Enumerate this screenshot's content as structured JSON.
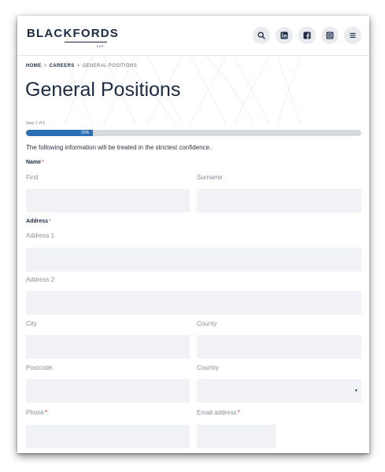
{
  "header": {
    "logo_text": "BLACKFORDS",
    "logo_sub": "LLP",
    "icons": [
      "search-icon",
      "linkedin-icon",
      "facebook-icon",
      "instagram-icon",
      "menu-icon"
    ]
  },
  "breadcrumb": {
    "home": "HOME",
    "sep1": ">",
    "careers": "CAREERS",
    "sep2": ">",
    "current": "GENERAL POSITIONS"
  },
  "page": {
    "title": "General Positions"
  },
  "progress": {
    "step_text": "Step 1 of 5",
    "percent": 20,
    "percent_text": "20%"
  },
  "form": {
    "intro": "The following information will be treated in the strictest confidence.",
    "required_marker": "*",
    "name": {
      "label": "Name",
      "first_label": "First",
      "first_value": "",
      "surname_label": "Surname",
      "surname_value": ""
    },
    "address": {
      "label": "Address",
      "address1_label": "Address 1",
      "address1_value": "",
      "address2_label": "Address 2",
      "address2_value": "",
      "city_label": "City",
      "city_value": "",
      "county_label": "County",
      "county_value": "",
      "postcode_label": "Postcode",
      "postcode_value": "",
      "country_label": "Country",
      "country_value": ""
    },
    "phone": {
      "label": "Phone",
      "value": ""
    },
    "email": {
      "label": "Email address",
      "value": ""
    }
  },
  "colors": {
    "brand_navy": "#1c2a44",
    "accent_blue": "#2b6fb7",
    "required_red": "#d0342c",
    "field_bg": "#f1f2f5"
  }
}
